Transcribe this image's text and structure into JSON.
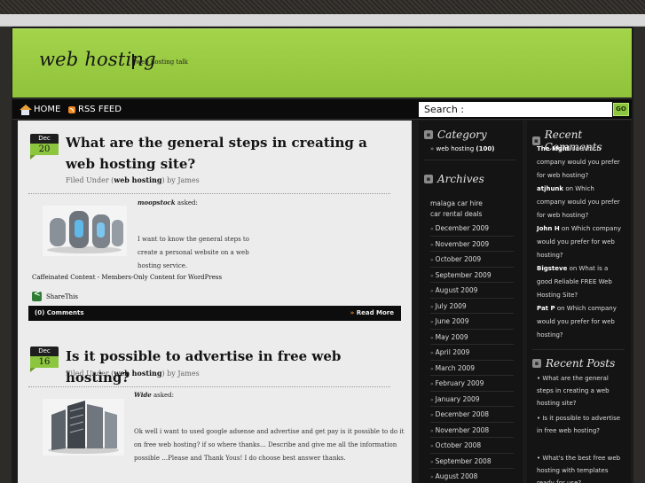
{
  "site": {
    "title": "web hosting",
    "tagline": "web hosting talk"
  },
  "nav": {
    "home": "HOME",
    "rss": "RSS FEED"
  },
  "search": {
    "label": "Search :",
    "button": "GO"
  },
  "posts": [
    {
      "month": "Dec",
      "day": "20",
      "title": "What are the general steps in creating a web hosting site?",
      "filed_prefix": "Filed Under (",
      "category": "web hosting",
      "filed_suffix": ") by James",
      "asker": "moopstock",
      "asked": "asked:",
      "body": "I want to know the general steps to create a personal website on a web hosting service.",
      "promo": "Caffeinated Content - Members-Only Content for WordPress",
      "share": "ShareThis",
      "comments": "(0) Comments",
      "read_more": "Read More"
    },
    {
      "month": "Dec",
      "day": "16",
      "title": "Is it possible to advertise in free web hosting?",
      "filed_prefix": "Filed Under (",
      "category": "web hosting",
      "filed_suffix": ") by James",
      "asker": "Wide",
      "asked": "asked:",
      "body": "Ok well i want to used google adsense and advertise and get pay is it possible to do it on free web hosting? if so where thanks… Describe and give me all the information possible …Please and Thank Yous! I do choose best answer thanks."
    }
  ],
  "sidebar": {
    "category_title": "Category",
    "category_link": "web hosting",
    "category_count": "(100)",
    "archives_title": "Archives",
    "archives_plain": [
      "malaga car hire",
      "car rental deals"
    ],
    "archives": [
      "December 2009",
      "November 2009",
      "October 2009",
      "September 2009",
      "August 2009",
      "July 2009",
      "June 2009",
      "May 2009",
      "April 2009",
      "March 2009",
      "February 2009",
      "January 2009",
      "December 2008",
      "November 2008",
      "October 2008",
      "September 2008",
      "August 2008"
    ],
    "recent_comments_title": "Recent Comments",
    "recent_comments": [
      {
        "author": "The Mgirl",
        "on": "on Which",
        "text": "company would you prefer for web hosting?"
      },
      {
        "author": "atjhunk",
        "on": "on Which",
        "text": "company would you prefer for web hosting?"
      },
      {
        "author": "John H",
        "on": "on Which",
        "text": "company would you prefer for web hosting?"
      },
      {
        "author": "Bigsteve",
        "on": "on What is a",
        "text": "good Reliable FREE Web Hosting Site?"
      },
      {
        "author": "Pat P",
        "on": "on Which company",
        "text": "would you prefer for web hosting?"
      }
    ],
    "recent_posts_title": "Recent Posts",
    "recent_posts": [
      "What are the general steps in creating a web hosting site?",
      "Is it possible to advertise in free web hosting?",
      "What's the best free web hosting with templates ready for use?"
    ]
  }
}
